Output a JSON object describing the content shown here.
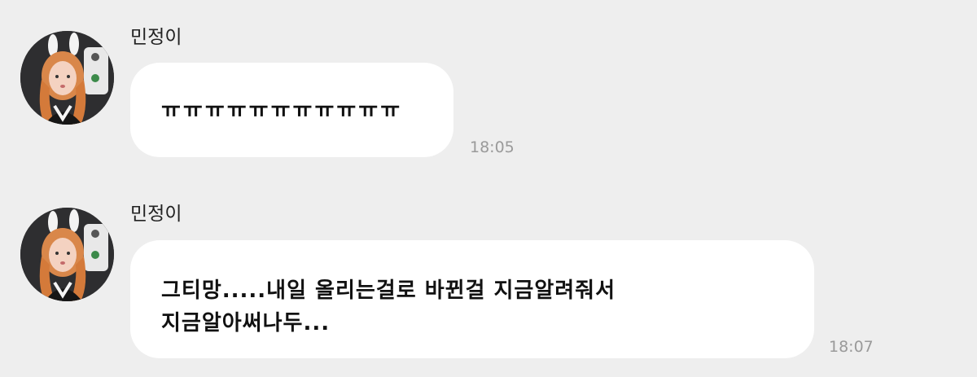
{
  "messages": [
    {
      "sender": "민정이",
      "text": "ㅠㅠㅠㅠㅠㅠㅠㅠㅠㅠㅠ",
      "time": "18:05"
    },
    {
      "sender": "민정이",
      "text": "그티망.....내일 올리는걸로 바뀐걸 지금알려줘서\n지금알아써나두...",
      "time": "18:07"
    }
  ],
  "colors": {
    "background": "#eeeeee",
    "bubble": "#ffffff",
    "time": "#9a9a9a"
  }
}
